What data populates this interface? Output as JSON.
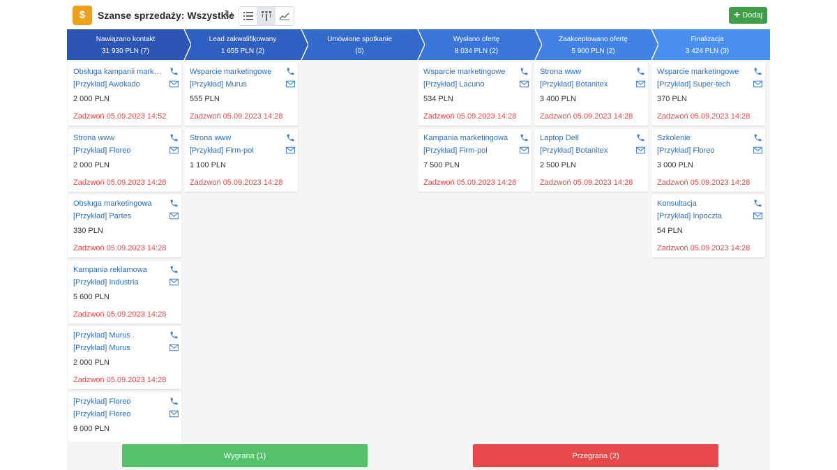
{
  "header": {
    "title": "Szanse sprzedaży: Wszystkie",
    "app_icon": "money-bag-icon",
    "views": [
      "list-view-icon",
      "pipeline-view-icon",
      "chart-view-icon"
    ],
    "active_view": "pipeline-view-icon",
    "add_label": "Dodaj"
  },
  "stages": [
    {
      "name": "Nawiązano kontakt",
      "value": "31 930 PLN (7)",
      "color": "#2d55b4"
    },
    {
      "name": "Lead zakwalifikowany",
      "value": "1 655 PLN (2)",
      "color": "#2f5fc0"
    },
    {
      "name": "Umówione spotkanie",
      "value": "(0)",
      "color": "#3469cc"
    },
    {
      "name": "Wysłano ofertę",
      "value": "8 034 PLN (2)",
      "color": "#3a75d8"
    },
    {
      "name": "Zaakceptowano ofertę",
      "value": "5 900 PLN (2)",
      "color": "#4282e6"
    },
    {
      "name": "Finalizacja",
      "value": "3 424 PLN (3)",
      "color": "#4a8ff0"
    }
  ],
  "columns": [
    {
      "cards": [
        {
          "title": "Obsługa kampanii marketingowej",
          "client": "[Przykład] Awokado",
          "value": "2 000 PLN",
          "task": "Zadzwoń 05.09.2023 14:52"
        },
        {
          "title": "Strona www",
          "client": "[Przykład] Floreo",
          "value": "2 000 PLN",
          "task": "Zadzwoń 05.09.2023 14:28"
        },
        {
          "title": "Obsługa marketingowa",
          "client": "[Przykład] Partes",
          "value": "330 PLN",
          "task": "Zadzwoń 05.09.2023 14:28"
        },
        {
          "title": "Kampania reklamowa",
          "client": "[Przykład] Industria",
          "value": "5 600 PLN",
          "task": "Zadzwoń 05.09.2023 14:28"
        },
        {
          "title": "[Przykład] Murus",
          "client": "[Przykład] Murus",
          "value": "2 000 PLN",
          "task": "Zadzwoń 05.09.2023 14:28"
        },
        {
          "title": "[Przykład] Floreo",
          "client": "[Przykład] Floreo",
          "value": "9 000 PLN",
          "task": ""
        }
      ]
    },
    {
      "cards": [
        {
          "title": "Wsparcie marketingowe",
          "client": "[Przykład] Murus",
          "value": "555 PLN",
          "task": "Zadzwoń 05.09.2023 14:28"
        },
        {
          "title": "Strona www",
          "client": "[Przykład] Firm-pol",
          "value": "1 100 PLN",
          "task": "Zadzwoń 05.09.2023 14:28"
        }
      ]
    },
    {
      "cards": []
    },
    {
      "cards": [
        {
          "title": "Wsparcie marketingowe",
          "client": "[Przykład] Lacuno",
          "value": "534 PLN",
          "task": "Zadzwoń 05.09.2023 14:28"
        },
        {
          "title": "Kampania marketingowa",
          "client": "[Przykład] Firm-pol",
          "value": "7 500 PLN",
          "task": "Zadzwoń 05.09.2023 14:28"
        }
      ]
    },
    {
      "cards": [
        {
          "title": "Strona www",
          "client": "[Przykład] Botanitex",
          "value": "3 400 PLN",
          "task": "Zadzwoń 05.09.2023 14:28"
        },
        {
          "title": "Laptop Dell",
          "client": "[Przykład] Botanitex",
          "value": "2 500 PLN",
          "task": "Zadzwoń 05.09.2023 14:28"
        }
      ]
    },
    {
      "cards": [
        {
          "title": "Wsparcie marketingowe",
          "client": "[Przykład] Super-tech",
          "value": "370 PLN",
          "task": "Zadzwoń 05.09.2023 14:28"
        },
        {
          "title": "Szkolenie",
          "client": "[Przykład] Floreo",
          "value": "3 000 PLN",
          "task": "Zadzwoń 05.09.2023 14:28"
        },
        {
          "title": "Konsultacja",
          "client": "[Przykład] Inpoczta",
          "value": "54 PLN",
          "task": "Zadzwoń 05.09.2023 14:28"
        }
      ]
    }
  ],
  "footer": {
    "won_label": "Wygrana (1)",
    "lost_label": "Przegrana (2)"
  },
  "colors": {
    "link": "#2c6ec0",
    "task_overdue": "#e24848",
    "won": "#53c26a",
    "lost": "#e9484a",
    "add": "#3f9e4a"
  }
}
